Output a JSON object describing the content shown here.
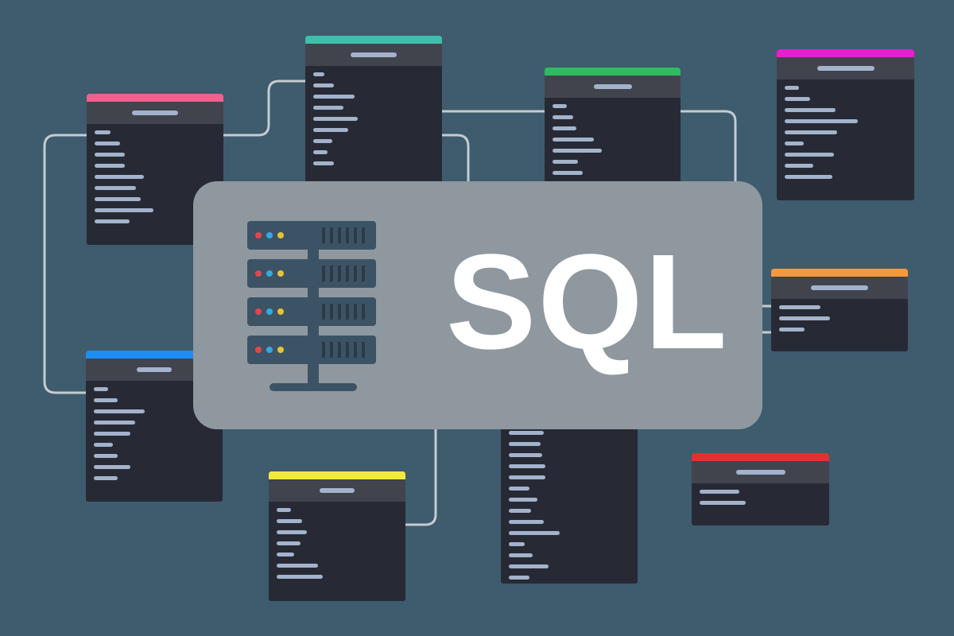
{
  "banner": {
    "title": "SQL",
    "background_color": "#3f5b6e",
    "panel_color": "#8f989f",
    "text_color": "#ffffff",
    "connector_color": "#c4ccd1"
  },
  "server_icon": {
    "name": "server-rack-icon",
    "units": 4,
    "unit_color": "#3c5366",
    "led_colors": [
      "#e0474c",
      "#3aa7e0",
      "#e8c331"
    ]
  },
  "tables": [
    {
      "id": "pink",
      "accent": "#f0618d",
      "rows": 9
    },
    {
      "id": "teal",
      "accent": "#3ebfa9",
      "rows": 10
    },
    {
      "id": "green",
      "accent": "#2fbb62",
      "rows": 7
    },
    {
      "id": "magenta",
      "accent": "#e51fd0",
      "rows": 9
    },
    {
      "id": "blue",
      "accent": "#1e8ef5",
      "rows": 9
    },
    {
      "id": "orange",
      "accent": "#f59a3b",
      "rows": 3
    },
    {
      "id": "yellow",
      "accent": "#f2ea3b",
      "rows": 7
    },
    {
      "id": "dark",
      "accent": "#272a34",
      "rows": 14
    },
    {
      "id": "red",
      "accent": "#e23030",
      "rows": 2
    }
  ]
}
